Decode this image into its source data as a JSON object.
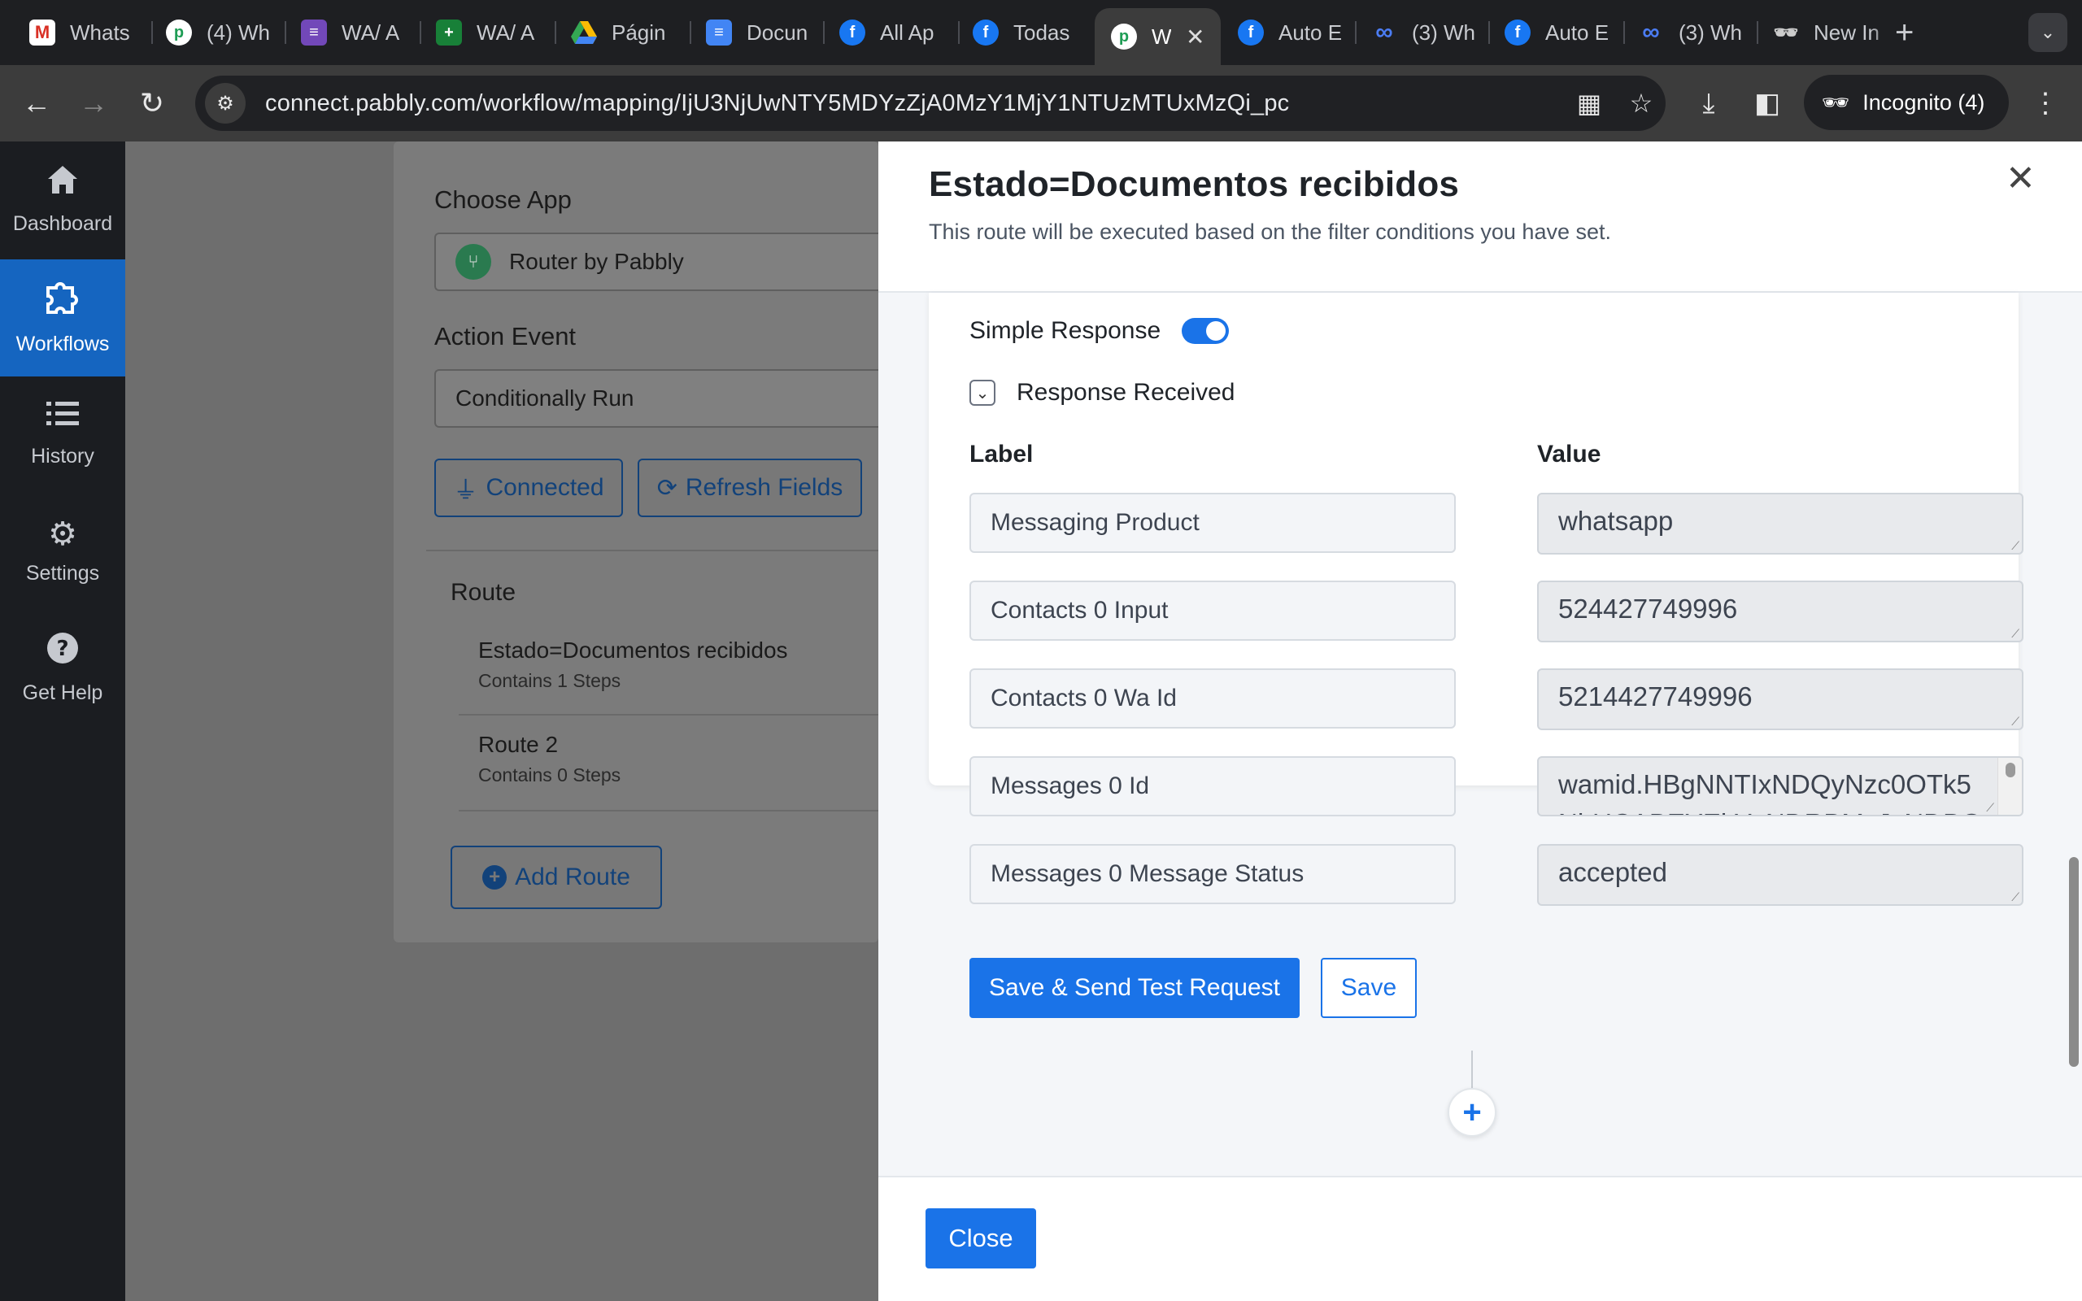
{
  "browser": {
    "tabs": [
      {
        "label": "Whats",
        "icon": "gmail-icon"
      },
      {
        "label": "(4) Wh",
        "icon": "pabbly-icon"
      },
      {
        "label": "WA/ A",
        "icon": "forms-icon"
      },
      {
        "label": "WA/ A",
        "icon": "sheets-icon"
      },
      {
        "label": "Págin",
        "icon": "drive-icon"
      },
      {
        "label": "Docun",
        "icon": "docs-icon"
      },
      {
        "label": "All Ap",
        "icon": "facebook-icon"
      },
      {
        "label": "Todas",
        "icon": "facebook-icon"
      },
      {
        "label": "W",
        "icon": "pabbly-icon",
        "active": true
      },
      {
        "label": "Auto E",
        "icon": "facebook-icon"
      },
      {
        "label": "(3) Wh",
        "icon": "meta-icon"
      },
      {
        "label": "Auto E",
        "icon": "facebook-icon"
      },
      {
        "label": "(3) Wh",
        "icon": "meta-icon"
      },
      {
        "label": "New In",
        "icon": "incognito-icon"
      }
    ],
    "url": "connect.pabbly.com/workflow/mapping/IjU3NjUwNTY5MDYzZjA0MzY1MjY1NTUzMTUxMzQi_pc",
    "incognito_label": "Incognito (4)"
  },
  "sidebar": {
    "items": [
      {
        "label": "Dashboard",
        "icon": "home-icon"
      },
      {
        "label": "Workflows",
        "icon": "puzzle-icon",
        "active": true
      },
      {
        "label": "History",
        "icon": "list-icon"
      },
      {
        "label": "Settings",
        "icon": "gear-icon"
      },
      {
        "label": "Get Help",
        "icon": "help-icon"
      }
    ]
  },
  "background": {
    "choose_app_label": "Choose App",
    "app_name": "Router by Pabbly",
    "action_event_label": "Action Event",
    "action_event_value": "Conditionally Run",
    "connected_label": "Connected",
    "refresh_label": "Refresh Fields",
    "route_heading": "Route",
    "routes": [
      {
        "name": "Estado=Documentos recibidos",
        "steps": "Contains 1 Steps"
      },
      {
        "name": "Route 2",
        "steps": "Contains 0 Steps"
      }
    ],
    "add_route_label": "Add Route"
  },
  "drawer": {
    "title": "Estado=Documentos recibidos",
    "subtitle": "This route will be executed based on the filter conditions you have set.",
    "simple_response_label": "Simple Response",
    "simple_response_on": true,
    "response_received_label": "Response Received",
    "label_header": "Label",
    "value_header": "Value",
    "fields": [
      {
        "label": "Messaging Product",
        "value": "whatsapp"
      },
      {
        "label": "Contacts 0 Input",
        "value": "524427749996"
      },
      {
        "label": "Contacts 0 Wa Id",
        "value": "5214427749996"
      },
      {
        "label": "Messages 0 Id",
        "value": "wamid.HBgNNTIxNDQyNzc0OTk5",
        "value_cut": "NhUCABEYEkYzNDRBMzJsNDBG"
      },
      {
        "label": "Messages 0 Message Status",
        "value": "accepted"
      }
    ],
    "save_send_label": "Save & Send Test Request",
    "save_label": "Save",
    "close_label": "Close"
  },
  "colors": {
    "accent": "#1a73e8",
    "sidebar_active": "#1565c0",
    "sidebar_bg": "#1b1d21"
  }
}
